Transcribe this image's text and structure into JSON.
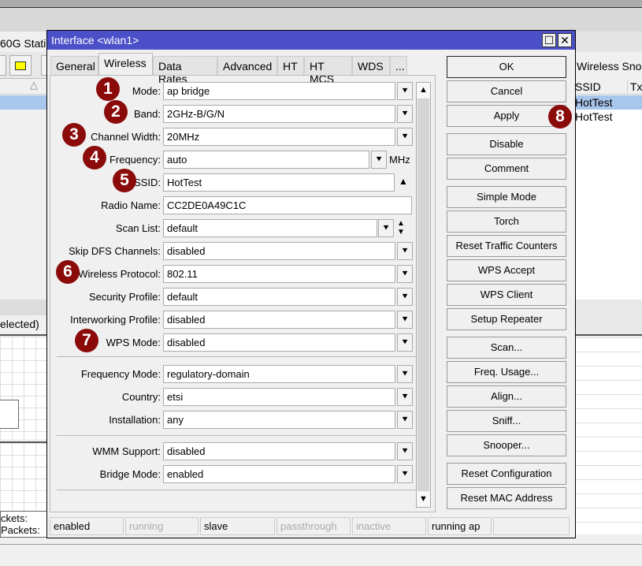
{
  "background": {
    "window_fragment": "60G Statio",
    "tab_fragment": "Wireless Snoo",
    "table_headers": [
      "SSID",
      "Tx"
    ],
    "table_rows": [
      "HotTest",
      "HotTest"
    ],
    "selected_fragment": "elected)",
    "packet_labels": [
      "ckets:",
      "Packets:"
    ]
  },
  "dialog": {
    "title": "Interface <wlan1>",
    "restore": "☐",
    "close": "✕"
  },
  "tabs": [
    "General",
    "Wireless",
    "Data Rates",
    "Advanced",
    "HT",
    "HT MCS",
    "WDS",
    "..."
  ],
  "active_tab": "Wireless",
  "fields": [
    {
      "label": "Mode:",
      "value": "ap bridge",
      "control": "dd",
      "badge": "1"
    },
    {
      "label": "Band:",
      "value": "2GHz-B/G/N",
      "control": "dd",
      "badge": "2"
    },
    {
      "label": "Channel Width:",
      "value": "20MHz",
      "control": "dd",
      "badge": "3"
    },
    {
      "label": "Frequency:",
      "value": "auto",
      "control": "mhz",
      "badge": "4",
      "unit": "MHz"
    },
    {
      "label": "SSID:",
      "value": "HotTest",
      "control": "up",
      "badge": "5"
    },
    {
      "label": "Radio Name:",
      "value": "CC2DE0A49C1C",
      "control": "none"
    },
    {
      "label": "Scan List:",
      "value": "default",
      "control": "updown"
    },
    {
      "label": "Skip DFS Channels:",
      "value": "disabled",
      "control": "dd"
    },
    {
      "label": "Wireless Protocol:",
      "value": "802.11",
      "control": "dd",
      "badge": "6"
    },
    {
      "label": "Security Profile:",
      "value": "default",
      "control": "dd"
    },
    {
      "label": "Interworking Profile:",
      "value": "disabled",
      "control": "dd"
    },
    {
      "label": "WPS Mode:",
      "value": "disabled",
      "control": "dd",
      "badge": "7"
    },
    {
      "label": "Frequency Mode:",
      "value": "regulatory-domain",
      "control": "dd"
    },
    {
      "label": "Country:",
      "value": "etsi",
      "control": "dd"
    },
    {
      "label": "Installation:",
      "value": "any",
      "control": "dd"
    },
    {
      "label": "WMM Support:",
      "value": "disabled",
      "control": "dd"
    },
    {
      "label": "Bridge Mode:",
      "value": "enabled",
      "control": "dd"
    }
  ],
  "buttons": [
    "OK",
    "Cancel",
    "Apply",
    "Disable",
    "Comment",
    "Simple Mode",
    "Torch",
    "Reset Traffic Counters",
    "WPS Accept",
    "WPS Client",
    "Setup Repeater",
    "Scan...",
    "Freq. Usage...",
    "Align...",
    "Sniff...",
    "Snooper...",
    "Reset Configuration",
    "Reset MAC Address"
  ],
  "apply_badge": "8",
  "status": [
    {
      "text": "enabled",
      "active": true
    },
    {
      "text": "running",
      "active": false
    },
    {
      "text": "slave",
      "active": true
    },
    {
      "text": "passthrough",
      "active": false
    },
    {
      "text": "inactive",
      "active": false
    },
    {
      "text": "running ap",
      "active": true
    },
    {
      "text": "",
      "active": true
    }
  ],
  "colors": {
    "titlebar": "#4b50c8",
    "badge": "#8b0b0b",
    "selection": "#a9c6ec"
  }
}
